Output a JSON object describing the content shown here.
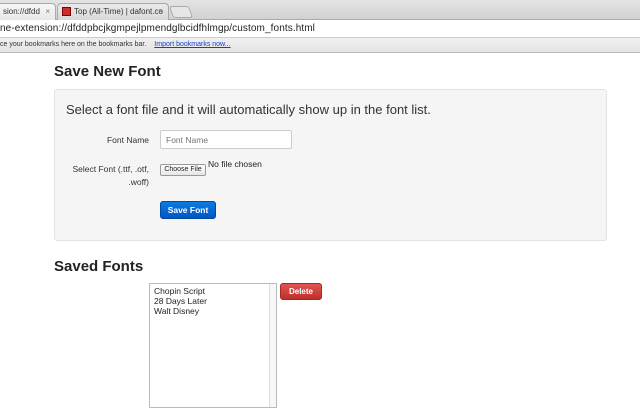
{
  "browser": {
    "tabs": [
      {
        "label": "sion://dfdd"
      },
      {
        "label": "Top (All-Time) | dafont.co"
      }
    ],
    "address": "ne-extension://dfddpbcjkgmpejlpmendglbcidfhlmgp/custom_fonts.html",
    "bookmarks_text": "ce your bookmarks here on the bookmarks bar.",
    "import_link": "Import bookmarks now..."
  },
  "save_section": {
    "heading": "Save New Font",
    "description": "Select a font file and it will automatically show up in the font list.",
    "font_name_label": "Font Name",
    "font_name_placeholder": "Font Name",
    "select_font_label_1": "Select Font (.ttf, .otf,",
    "select_font_label_2": ".woff)",
    "choose_file": "Choose File",
    "no_file": "No file chosen",
    "save_button": "Save Font"
  },
  "saved_section": {
    "heading": "Saved Fonts",
    "fonts": [
      "Chopin Script",
      "28 Days Later",
      "Walt Disney"
    ],
    "delete_button": "Delete"
  }
}
